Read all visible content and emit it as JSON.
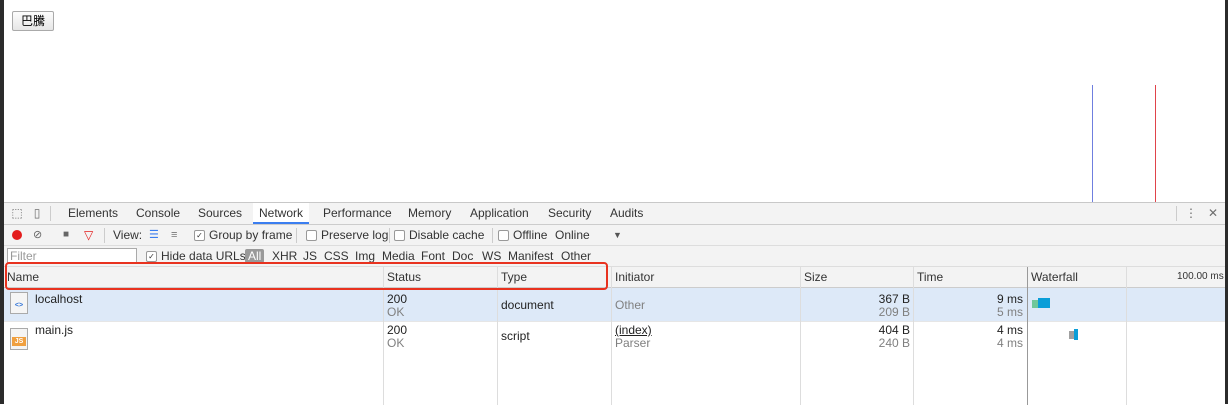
{
  "page": {
    "button_label": "巴騰"
  },
  "devtools": {
    "tabs": [
      "Elements",
      "Console",
      "Sources",
      "Network",
      "Performance",
      "Memory",
      "Application",
      "Security",
      "Audits"
    ],
    "active_tab": "Network",
    "toolbar": {
      "view_label": "View:",
      "group_by_frame": "Group by frame",
      "preserve_log": "Preserve log",
      "disable_cache": "Disable cache",
      "offline": "Offline",
      "throttle": "Online"
    },
    "filter": {
      "placeholder": "Filter",
      "hide_data_urls": "Hide data URLs",
      "types": [
        "All",
        "XHR",
        "JS",
        "CSS",
        "Img",
        "Media",
        "Font",
        "Doc",
        "WS",
        "Manifest",
        "Other"
      ]
    },
    "columns": {
      "name": "Name",
      "status": "Status",
      "type": "Type",
      "initiator": "Initiator",
      "size": "Size",
      "time": "Time",
      "waterfall": "Waterfall",
      "waterfall_scale": "100.00 ms"
    },
    "requests": [
      {
        "name": "localhost",
        "icon": "html-file-icon",
        "icon_tag": "<>",
        "status": "200",
        "status_text": "OK",
        "type": "document",
        "initiator": "Other",
        "initiator_sub": "",
        "size": "367 B",
        "size_sub": "209 B",
        "time": "9 ms",
        "time_sub": "5 ms"
      },
      {
        "name": "main.js",
        "icon": "js-file-icon",
        "icon_tag": "JS",
        "status": "200",
        "status_text": "OK",
        "type": "script",
        "initiator": "(index)",
        "initiator_sub": "Parser",
        "size": "404 B",
        "size_sub": "240 B",
        "time": "4 ms",
        "time_sub": "4 ms"
      }
    ],
    "colors": {
      "accent": "#3b7ef0",
      "highlight": "#e8321f",
      "record": "#e31c1c",
      "selected_row": "#dde9f8"
    }
  }
}
